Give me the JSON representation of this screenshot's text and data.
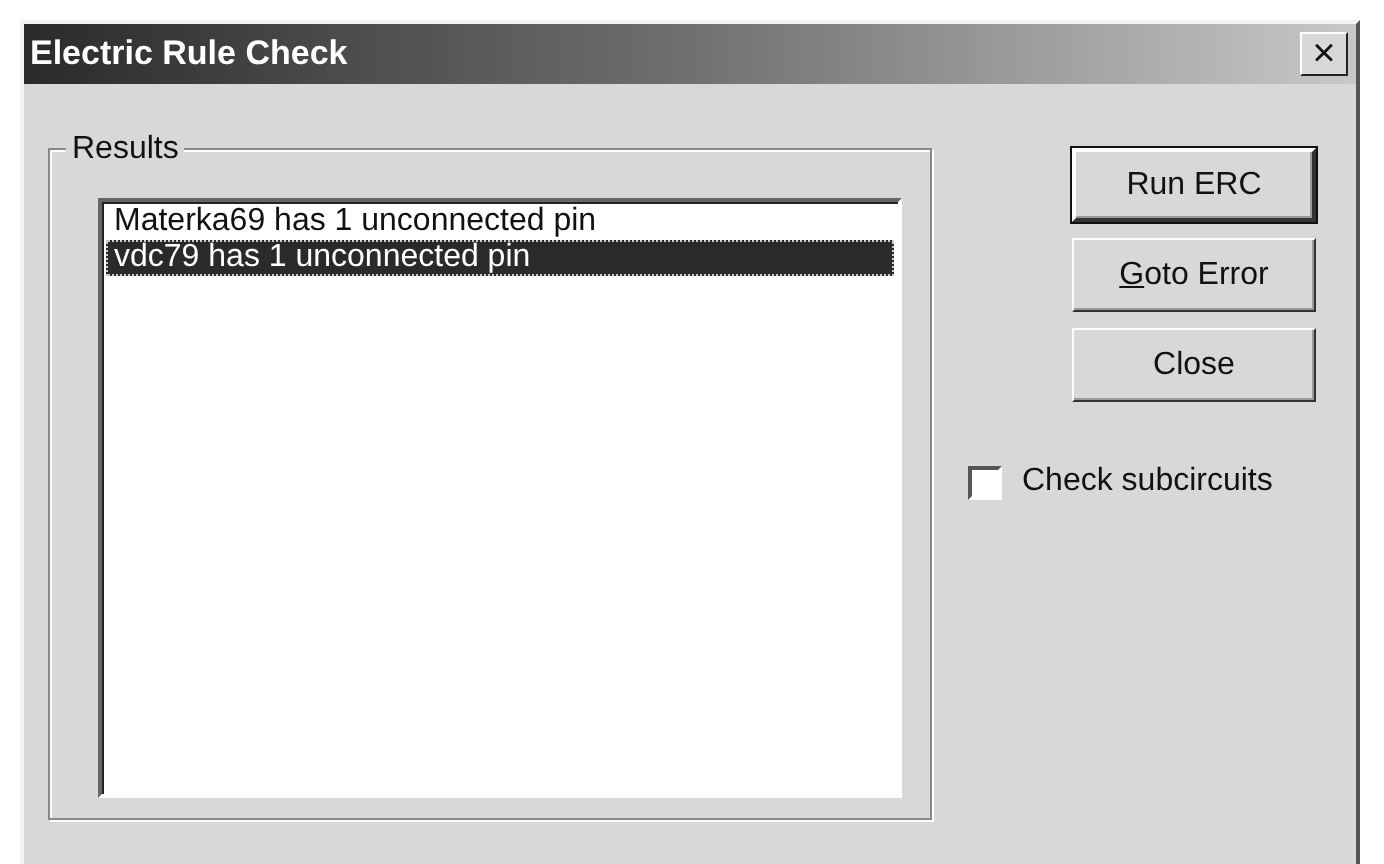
{
  "window": {
    "title": "Electric Rule Check",
    "close": "×"
  },
  "results": {
    "label": "Results",
    "items": [
      {
        "text": "Materka69 has 1 unconnected pin",
        "selected": false
      },
      {
        "text": "vdc79 has 1 unconnected pin",
        "selected": true
      }
    ]
  },
  "buttons": [
    {
      "label": "Run ERC",
      "default": true,
      "mnemonic": false
    },
    {
      "label": "Goto Error",
      "default": false,
      "mnemonic": true
    },
    {
      "label": "Close",
      "default": false,
      "mnemonic": false
    }
  ],
  "check_subcircuits": {
    "label": "Check subcircuits",
    "checked": false
  }
}
